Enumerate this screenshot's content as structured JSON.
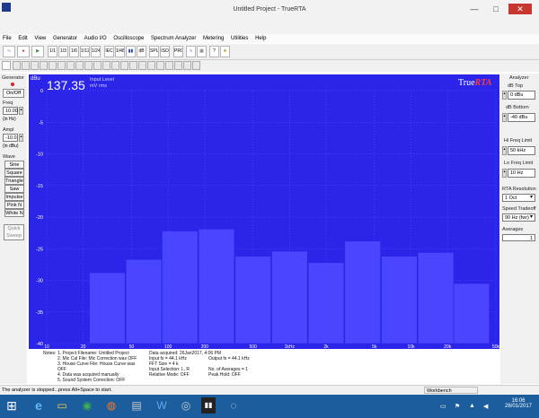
{
  "window": {
    "title": "Untitled Project - TrueRTA",
    "minimize": "—",
    "maximize": "□",
    "close": "✕"
  },
  "menu": [
    "File",
    "Edit",
    "View",
    "Generator",
    "Audio I/O",
    "Oscilloscope",
    "Spectrum Analyzer",
    "Metering",
    "Utilities",
    "Help"
  ],
  "toolbar": {
    "buttons": [
      "1/1",
      "1/3",
      "1/6",
      "1/12",
      "1/24",
      "IEC",
      "1/48",
      "dB",
      "SPL",
      "ISO",
      "PRO",
      "?",
      "?"
    ]
  },
  "generator": {
    "title": "Generator",
    "onoff": "On/Off",
    "freq_label": "Freq",
    "freq_value": "10.00",
    "freq_unit": "(in Hz)",
    "ampl_label": "Ampl",
    "ampl_value": "-10.0",
    "ampl_unit": "(in dBu)",
    "wave_label": "Wave",
    "waves": [
      "Sine",
      "Square",
      "Triangle",
      "Saw",
      "Impulse",
      "Pink N",
      "White N"
    ],
    "quick_sweep": "Quick Sweep"
  },
  "display": {
    "dbu_label": "dBu",
    "readout_value": "137.35",
    "readout_line1": "Input Level",
    "readout_line2": "mV rms",
    "logo_true": "True",
    "logo_rta": "RTA"
  },
  "analyzer": {
    "title": "Analyzer",
    "db_top_label": "dB Top",
    "db_top_value": "0 dBu",
    "db_bottom_label": "dB Bottom",
    "db_bottom_value": "-40 dBu",
    "hi_freq_label": "Hi Freq Limit",
    "hi_freq_value": "50 kHz",
    "lo_freq_label": "Lo Freq Limit",
    "lo_freq_value": "10 Hz",
    "resolution_label": "RTA Resolution",
    "resolution_value": "1 Oct",
    "speed_label": "Speed Tradeoff",
    "speed_value": "90 Hz (fwr)",
    "averages_label": "Averages",
    "averages_value": "1"
  },
  "notes": {
    "title": "Notes:",
    "col1": [
      "1. Project Filename: Untitled Project",
      "2. Mic Cal File: Mic Correction was OFF",
      "3. House Curve File: House Curve was OFF",
      "4. Data was acquired manually",
      "5. Sound System Correction: OFF"
    ],
    "col2": [
      "Data acquired: 26Jan2017, 4:06 PM",
      "Input fs = 44.1 kHz",
      "FFT Size = 4 k",
      "Input Selection: L, R",
      "Relative Mode: OFF"
    ],
    "col3": [
      "Output fs = 44.1 kHz",
      "",
      "No. of Averages = 1",
      "Peak Hold: OFF"
    ]
  },
  "status": {
    "text": "The analyzer is stopped...press Alt+Space to start.",
    "workbench": "Workbench"
  },
  "taskbar": {
    "time": "16:06",
    "date": "26/01/2017"
  },
  "chart_data": {
    "type": "bar",
    "ylim": [
      -40,
      0
    ],
    "yticks": [
      "0",
      "-5",
      "-10",
      "-15",
      "-20",
      "-25",
      "-30",
      "-35",
      "-40"
    ],
    "xticks": [
      "10",
      "20",
      "50",
      "100",
      "200",
      "500",
      "1kHz",
      "2k",
      "5k",
      "10k",
      "20k",
      "50k"
    ],
    "categories": [
      "31",
      "63",
      "125",
      "250",
      "500",
      "1k",
      "2k",
      "4k",
      "8k",
      "16k"
    ],
    "values": [
      -28.8,
      -26.7,
      -22.2,
      -21.9,
      -26.2,
      -25.4,
      -27.2,
      -23.8,
      -26.2,
      -25.6,
      -30.5
    ],
    "bar_color": "#4a46ff",
    "plot_color": "#2a25e8",
    "grid": true
  }
}
